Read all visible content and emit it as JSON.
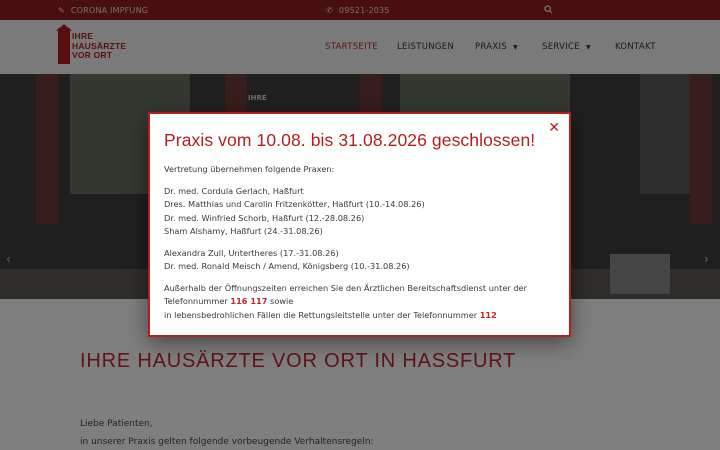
{
  "topbar": {
    "corona": {
      "icon": "syringe-icon",
      "label": "CORONA IMPFUNG"
    },
    "phone": {
      "icon": "phone-icon",
      "number": "09521-2035"
    },
    "search": {
      "icon": "search-icon"
    }
  },
  "header": {
    "logo_text": "IHRE\nHAUSÄRZTE\nVOR ORT",
    "nav": [
      {
        "label": "STARTSEITE",
        "active": true
      },
      {
        "label": "LEISTUNGEN"
      },
      {
        "label": "PRAXIS",
        "dropdown": true
      },
      {
        "label": "SERVICE",
        "dropdown": true
      },
      {
        "label": "KONTAKT"
      }
    ]
  },
  "hero": {
    "sign_text": "IHRE",
    "prev_icon": "chevron-left-icon",
    "next_icon": "chevron-right-icon"
  },
  "main": {
    "title": "IHRE HAUSÄRZTE VOR ORT IN HASSFURT",
    "line1": "Liebe Patienten,",
    "line2": "in unserer Praxis gelten folgende vorbeugende Verhaltensregeln:"
  },
  "modal": {
    "close_icon": "close-icon",
    "title": "Praxis vom 10.08. bis 31.08.2026 geschlossen!",
    "intro": "Vertretung übernehmen folgende Praxen:",
    "group1": [
      "Dr. med. Cordula Gerlach, Haßfurt",
      "Dres. Matthias und Carolin Fritzenkötter, Haßfurt (10.-14.08.26)",
      "Dr. med. Winfried Schorb, Haßfurt (12.-28.08.26)",
      "Sham Alshamy, Haßfurt (24.-31.08.26)"
    ],
    "group2": [
      "Alexandra Zull, Untertheres (17.-31.08.26)",
      "Dr. med. Ronald Meisch / Amend, Königsberg (10.-31.08.26)"
    ],
    "after_hours_line1": "Außerhalb der Öffnungszeiten erreichen Sie den Ärztlichen Bereitschaftsdienst unter der",
    "after_hours_prefix": "Telefonnummer",
    "after_hours_number": "116 117",
    "after_hours_suffix": "sowie",
    "emergency_text": "in lebensbedrohlichen Fällen die Rettungsleitstelle unter der Telefonnummer",
    "emergency_number": "112"
  },
  "colors": {
    "brand": "#b21f1f",
    "accent": "#c2272d",
    "topbar": "#8e1f1f"
  }
}
